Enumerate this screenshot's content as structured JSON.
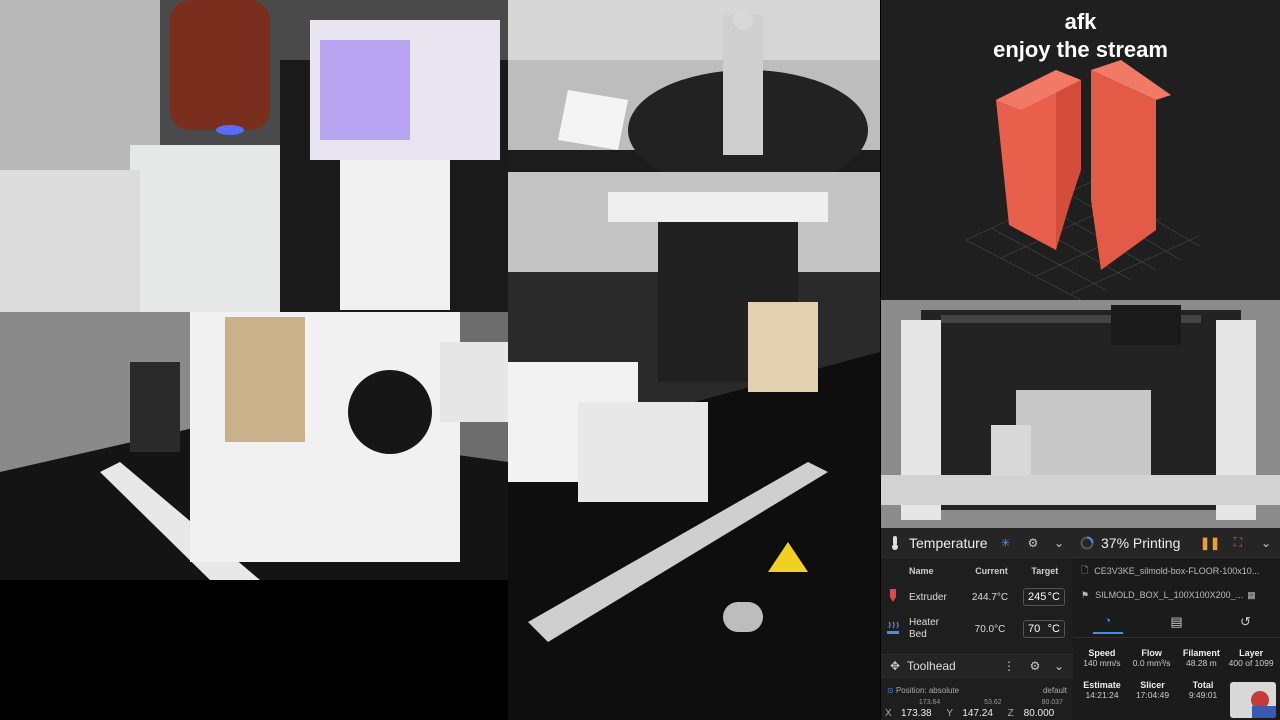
{
  "overlay": {
    "line1": "afk",
    "line2": "enjoy the stream"
  },
  "temperature": {
    "title": "Temperature",
    "columns": {
      "name": "Name",
      "current": "Current",
      "target": "Target"
    },
    "rows": [
      {
        "name": "Extruder",
        "current": "244.7°C",
        "target_value": "245",
        "target_unit": "°C"
      },
      {
        "name_line1": "Heater",
        "name_line2": "Bed",
        "current": "70.0°C",
        "target_value": "70",
        "target_unit": "°C"
      }
    ]
  },
  "toolhead": {
    "title": "Toolhead",
    "position_mode": "Position: absolute",
    "speed_profile": "default",
    "axes": [
      {
        "label": "X",
        "requested": "173.64",
        "value": "173.38"
      },
      {
        "label": "Y",
        "requested": "53.62",
        "value": "147.24"
      },
      {
        "label": "Z",
        "requested": "80.037",
        "value": "80.000"
      }
    ]
  },
  "status": {
    "progress_label": "37% Printing",
    "progress": 0.37,
    "file": "CE3V3KE_silmold-box-FLOOR-100x10...",
    "object": "SILMOLD_BOX_L_100X100X200_...",
    "stats_row1": [
      {
        "key": "Speed",
        "value": "140 mm/s"
      },
      {
        "key": "Flow",
        "value": "0.0 mm³/s"
      },
      {
        "key": "Filament",
        "value": "48.28 m"
      },
      {
        "key": "Layer",
        "value": "400 of 1099"
      }
    ],
    "stats_row2": [
      {
        "key": "Estimate",
        "value": "14:21:24"
      },
      {
        "key": "Slicer",
        "value": "17:04:49"
      },
      {
        "key": "Total",
        "value": "9:49:01"
      }
    ]
  },
  "colors": {
    "accent": "#3f8ef0",
    "model": "#e8604c",
    "pause": "#f0a030",
    "extruder_icon": "#e0464a",
    "bed_icon": "#4a8ef0"
  },
  "icons": [
    "snowflake-icon",
    "gear-icon",
    "chevron-down-icon",
    "spinner-icon",
    "pause-icon",
    "cancel-icon",
    "file-icon",
    "pin-icon",
    "dashboard-icon",
    "document-icon",
    "history-icon",
    "crosshair-icon",
    "dots-icon"
  ]
}
